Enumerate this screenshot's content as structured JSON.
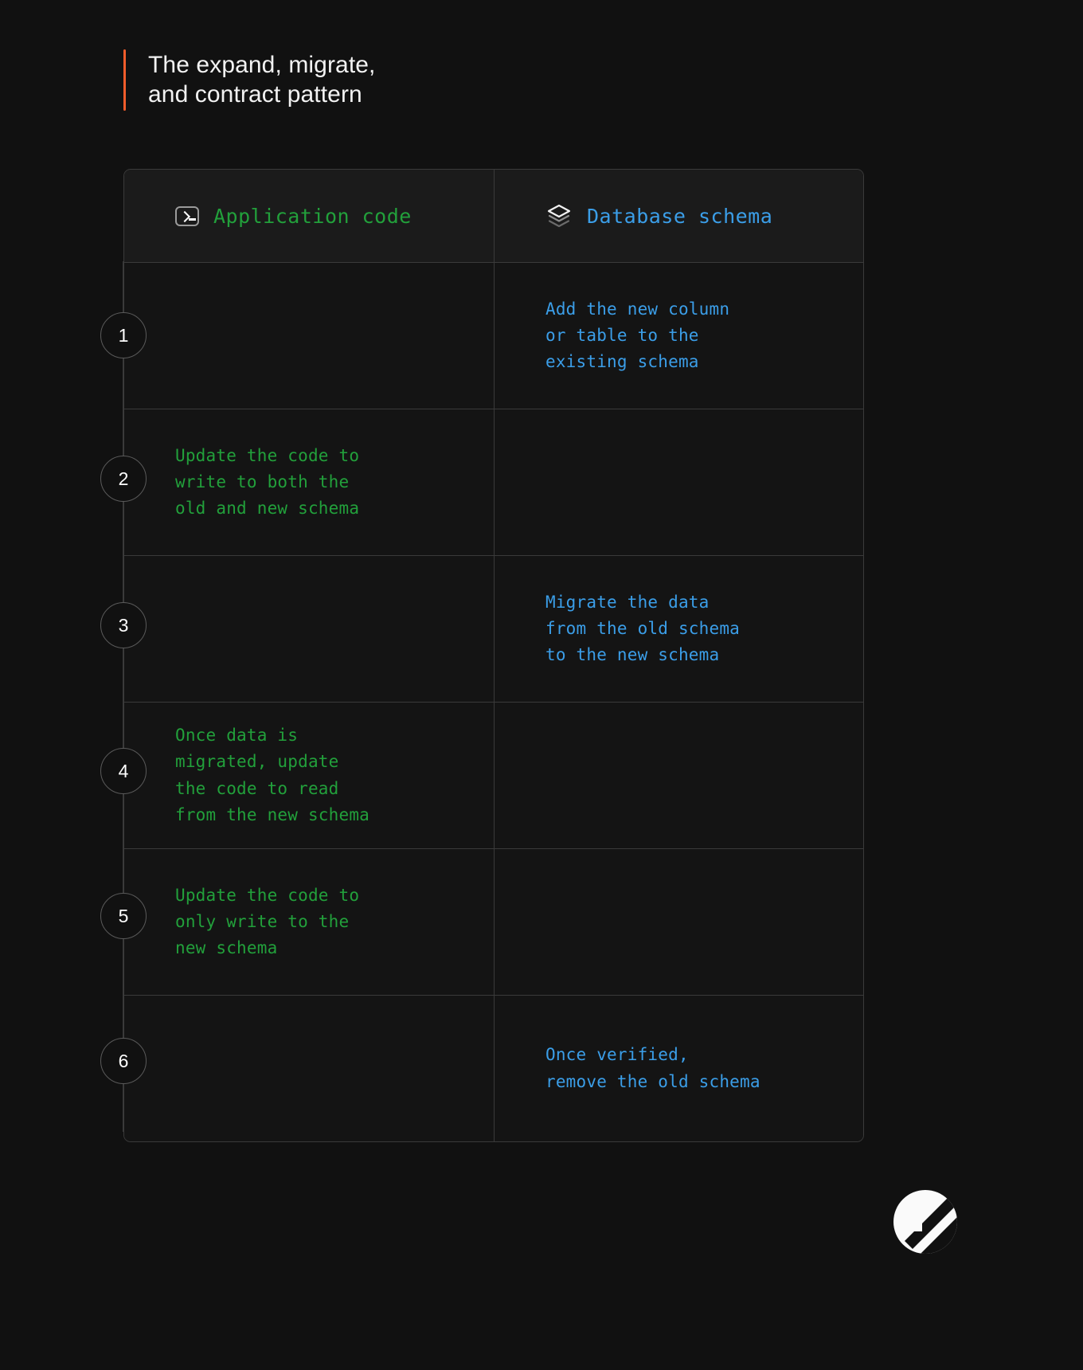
{
  "title": "The expand, migrate,\nand contract pattern",
  "accent_color": "#f25c2b",
  "colors": {
    "background": "#111111",
    "border": "#3a3a3a",
    "header_background": "#1b1b1b",
    "app_code_green": "#22a03b",
    "db_schema_blue": "#3b9ee8"
  },
  "table": {
    "columns": [
      {
        "label": "Application code",
        "icon": "terminal-icon",
        "color": "#22a03b"
      },
      {
        "label": "Database schema",
        "icon": "layers-icon",
        "color": "#3b9ee8"
      }
    ],
    "rows": [
      {
        "step": "1",
        "app_code": "",
        "db_schema": "Add the new column\nor table to the\nexisting schema"
      },
      {
        "step": "2",
        "app_code": "Update the code to\nwrite to both the\nold and new schema",
        "db_schema": ""
      },
      {
        "step": "3",
        "app_code": "",
        "db_schema": "Migrate the data\nfrom the old schema\nto the new schema"
      },
      {
        "step": "4",
        "app_code": "Once data is\nmigrated, update\nthe code to read\nfrom the new schema",
        "db_schema": ""
      },
      {
        "step": "5",
        "app_code": "Update the code to\nonly write to the\nnew schema",
        "db_schema": ""
      },
      {
        "step": "6",
        "app_code": "",
        "db_schema": "Once verified,\nremove the old schema"
      }
    ]
  },
  "logo": {
    "name": "planetscale-logo",
    "color": "#fafafa"
  }
}
